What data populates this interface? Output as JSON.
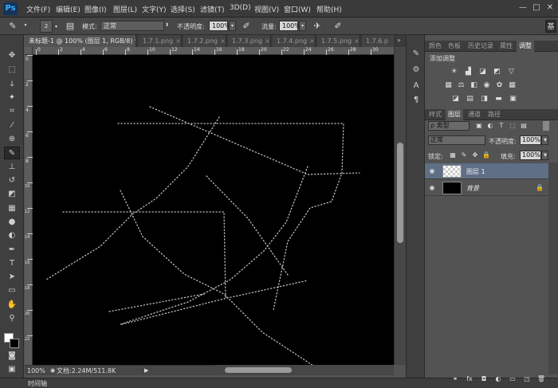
{
  "app": {
    "logo": "Ps"
  },
  "menu": [
    "文件(F)",
    "编辑(E)",
    "图像(I)",
    "图层(L)",
    "文字(Y)",
    "选择(S)",
    "滤镜(T)",
    "3D(D)",
    "视图(V)",
    "窗口(W)",
    "帮助(H)"
  ],
  "window_controls": {
    "minimize": "—",
    "maximize": "□",
    "close": "✕"
  },
  "options": {
    "brush_size": "2",
    "mode_label": "模式:",
    "mode_value": "正常",
    "opacity_label": "不透明度:",
    "opacity_value": "100%",
    "flow_label": "流量:",
    "flow_value": "100%",
    "workspace": "基"
  },
  "doc_tabs": [
    {
      "label": "未标题-1 @ 100% (图层 1, RGB/8) *",
      "close": "×",
      "active": true
    },
    {
      "label": "1.7.1.png",
      "close": "×",
      "active": false
    },
    {
      "label": "1.7.2.png",
      "close": "×",
      "active": false
    },
    {
      "label": "1.7.3.png",
      "close": "×",
      "active": false
    },
    {
      "label": "1.7.4.png",
      "close": "×",
      "active": false
    },
    {
      "label": "1.7.5.png",
      "close": "×",
      "active": false
    },
    {
      "label": "1.7.6.p",
      "close": "",
      "active": false
    }
  ],
  "ruler_top_ticks": [
    "0",
    "2",
    "4",
    "6",
    "8",
    "10",
    "12",
    "14",
    "16",
    "18",
    "20",
    "22",
    "24",
    "26",
    "28",
    "30"
  ],
  "ruler_left_ticks": [
    "0",
    "2",
    "4",
    "6",
    "8",
    "10",
    "12",
    "14",
    "16",
    "18",
    "20",
    "22"
  ],
  "status": {
    "zoom": "100%",
    "doc_info": "文档:2.24M/511.8K"
  },
  "timeline": "时间轴",
  "panels": {
    "top_tabs": [
      "颜色",
      "色板",
      "历史记录",
      "属性",
      "调整"
    ],
    "adjust_title": "添加调整",
    "layer_tabs": [
      "样式",
      "图层",
      "通道",
      "路径"
    ],
    "filter_kind": "ρ 类型",
    "blend_mode": "正常",
    "opacity_label": "不透明度:",
    "opacity_value": "100%",
    "lock_label": "锁定:",
    "fill_label": "填充:",
    "fill_value": "100%",
    "layers": [
      {
        "name": "图层 1",
        "selected": true,
        "italic": false
      },
      {
        "name": "背景",
        "selected": false,
        "italic": true
      }
    ]
  },
  "colors": {
    "canvas": "#000000",
    "selected_layer": "#5e6f86",
    "stroke": "#bdbdbd"
  }
}
